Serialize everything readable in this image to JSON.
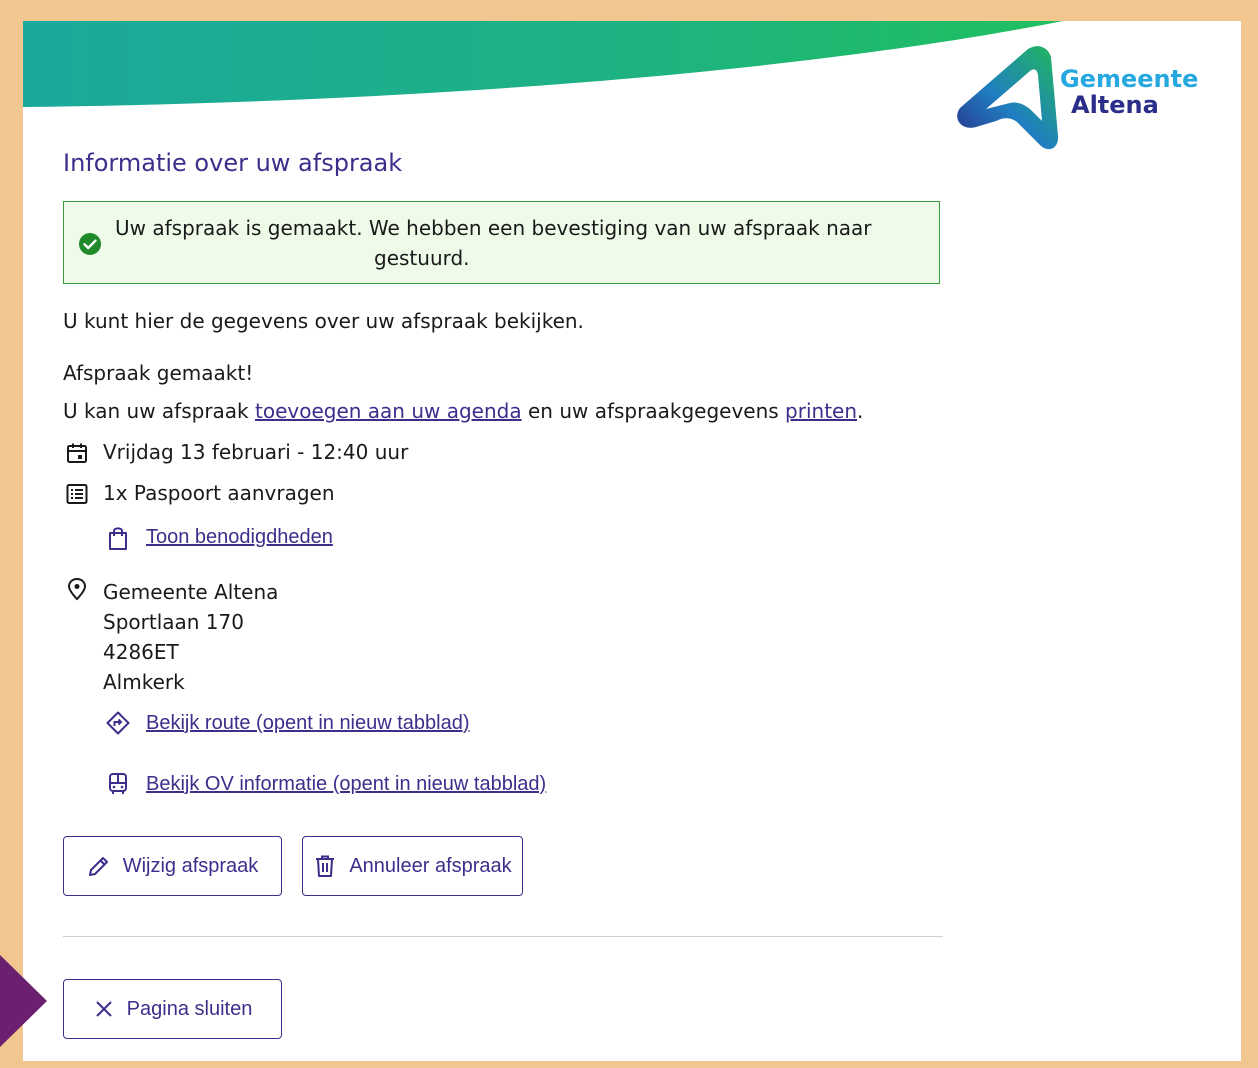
{
  "brand": {
    "line1": "Gemeente",
    "line2": "Altena"
  },
  "page_title": "Informatie over uw afspraak",
  "alert": {
    "line1": "Uw afspraak is gemaakt. We hebben een bevestiging van uw afspraak naar",
    "line2": "gestuurd."
  },
  "intro": "U kunt hier de gegevens over uw afspraak bekijken.",
  "made": "Afspraak gemaakt!",
  "agenda_sentence": {
    "before": "U kan uw afspraak ",
    "agenda_link": "toevoegen aan uw agenda",
    "middle": " en uw afspraakgegevens ",
    "print_link": "printen",
    "after": "."
  },
  "appointment": {
    "datetime": "Vrijdag 13 februari - 12:40 uur",
    "product": "1x Paspoort aanvragen",
    "requirements_link": "Toon benodigdheden"
  },
  "location": {
    "name": "Gemeente Altena",
    "street": "Sportlaan 170",
    "postcode": "4286ET",
    "city": "Almkerk",
    "route_link": "Bekijk route (opent in nieuw tabblad)",
    "ov_link": "Bekijk OV informatie (opent in nieuw tabblad)"
  },
  "buttons": {
    "change": "Wijzig afspraak",
    "cancel": "Annuleer afspraak",
    "close": "Pagina sluiten"
  },
  "colors": {
    "accent": "#3d2e8c",
    "success_border": "#3a9a3a",
    "success_bg": "#eefbe9",
    "frame": "#f2c78f",
    "marker": "#6b1f6f"
  },
  "icons": [
    "check-circle-icon",
    "calendar-icon",
    "list-icon",
    "bag-icon",
    "location-pin-icon",
    "route-icon",
    "bus-icon",
    "pencil-icon",
    "trash-icon",
    "close-icon"
  ]
}
